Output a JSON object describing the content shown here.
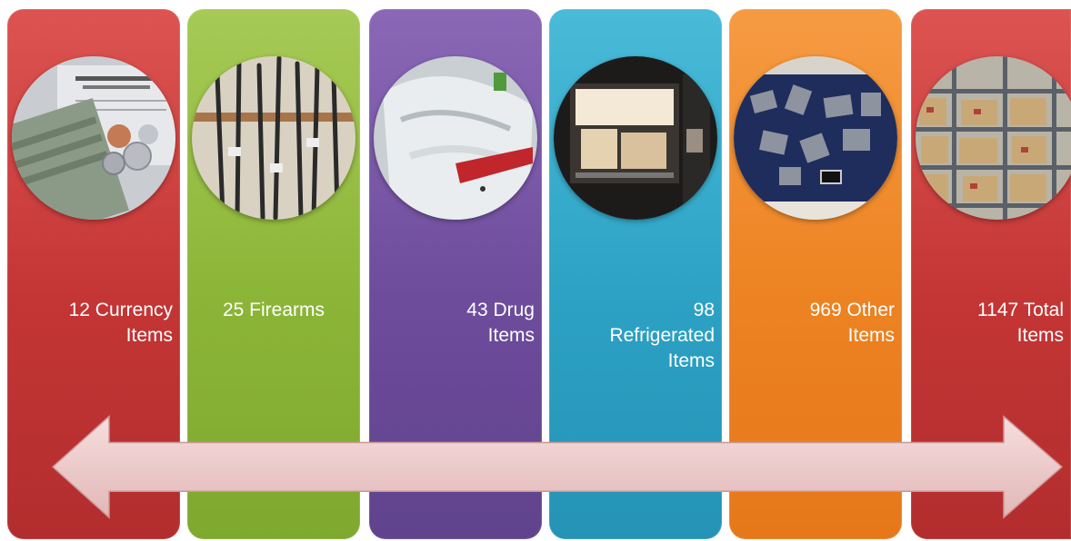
{
  "panels": [
    {
      "id": "currency",
      "label_line1": "12 Currency",
      "label_line2": "Items",
      "label_line3": "",
      "color_top": "#d8403e",
      "color_bottom": "#b32d2e",
      "photo_icon": "currency-photo"
    },
    {
      "id": "firearms",
      "label_line1": "25 Firearms",
      "label_line2": "",
      "label_line3": "",
      "color_top": "#9cc442",
      "color_bottom": "#7ea92e",
      "photo_icon": "firearms-photo"
    },
    {
      "id": "drug",
      "label_line1": "43 Drug",
      "label_line2": "Items",
      "label_line3": "",
      "color_top": "#7d57ae",
      "color_bottom": "#60438d",
      "photo_icon": "drug-evidence-photo"
    },
    {
      "id": "refrigerated",
      "label_line1": "98",
      "label_line2": "Refrigerated",
      "label_line3": "Items",
      "color_top": "#35b3d4",
      "color_bottom": "#2593b6",
      "photo_icon": "refrigerator-photo"
    },
    {
      "id": "other",
      "label_line1": "969 Other",
      "label_line2": "Items",
      "label_line3": "",
      "color_top": "#f58f2c",
      "color_bottom": "#e6781a",
      "photo_icon": "other-items-photo"
    },
    {
      "id": "total",
      "label_line1": "1147 Total",
      "label_line2": "Items",
      "label_line3": "",
      "color_top": "#d8403e",
      "color_bottom": "#b32d2e",
      "photo_icon": "evidence-shelves-photo"
    }
  ],
  "arrow": {
    "color": "#f1d0d0",
    "icon": "double-headed-arrow-icon"
  }
}
